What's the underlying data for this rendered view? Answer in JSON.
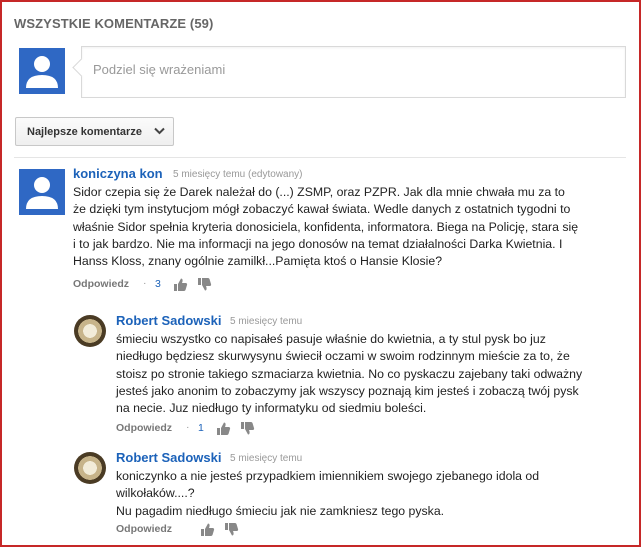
{
  "header": {
    "title": "WSZYSTKIE KOMENTARZE (59)"
  },
  "share": {
    "placeholder": "Podziel się wrażeniami"
  },
  "sort": {
    "label": "Najlepsze komentarze"
  },
  "comments": [
    {
      "author": "koniczyna kon",
      "time": "5 miesięcy temu (edytowany)",
      "lines": [
        "Sidor czepia się że Darek należał do (...) ZSMP, oraz PZPR. Jak dla mnie chwała mu za to",
        "że dzięki tym instytucjom mógł zobaczyć kawał świata. Wedle danych z ostatnich tygodni to",
        "właśnie Sidor spełnia kryteria donosiciela, konfidenta, informatora. Biega na Policję, stara się",
        "i to jak bardzo. Nie ma informacji na jego donosów na temat działalności Darka Kwietnia. I",
        "Hanss Kloss, znany ogólnie zamilkł...Pamięta ktoś o Hansie Klosie?"
      ],
      "reply_label": "Odpowiedz",
      "dot": "·",
      "likes": "3"
    },
    {
      "author": "Robert Sadowski",
      "time": "5 miesięcy temu",
      "lines": [
        "śmieciu wszystko co napisałeś pasuje właśnie do kwietnia, a ty stul pysk bo juz",
        "niedługo będziesz skurwysynu świecił oczami w swoim rodzinnym mieście za to, że",
        "stoisz po stronie takiego szmaciarza kwietnia. No co pyskaczu zajebany taki odważny",
        "jesteś jako anonim to zobaczymy jak wszyscy poznają kim jesteś i zobaczą twój pysk",
        "na necie. Juz niedługo ty informatyku od siedmiu boleści."
      ],
      "reply_label": "Odpowiedz",
      "dot": "·",
      "likes": "1"
    },
    {
      "author": "Robert Sadowski",
      "time": "5 miesięcy temu",
      "lines": [
        "koniczynko a nie jesteś przypadkiem imiennikiem swojego zjebanego idola od",
        "wilkołaków....?",
        "Nu pagadim niedługo śmieciu jak nie zamkniesz tego pyska."
      ],
      "reply_label": "Odpowiedz"
    }
  ],
  "colors": {
    "frame": "#c62828",
    "link": "#1c62b9",
    "avatar": "#2f68c4"
  },
  "icons": [
    "default-avatar-icon",
    "chevron-down-icon",
    "thumbs-up-icon",
    "thumbs-down-icon",
    "profile-photo"
  ]
}
